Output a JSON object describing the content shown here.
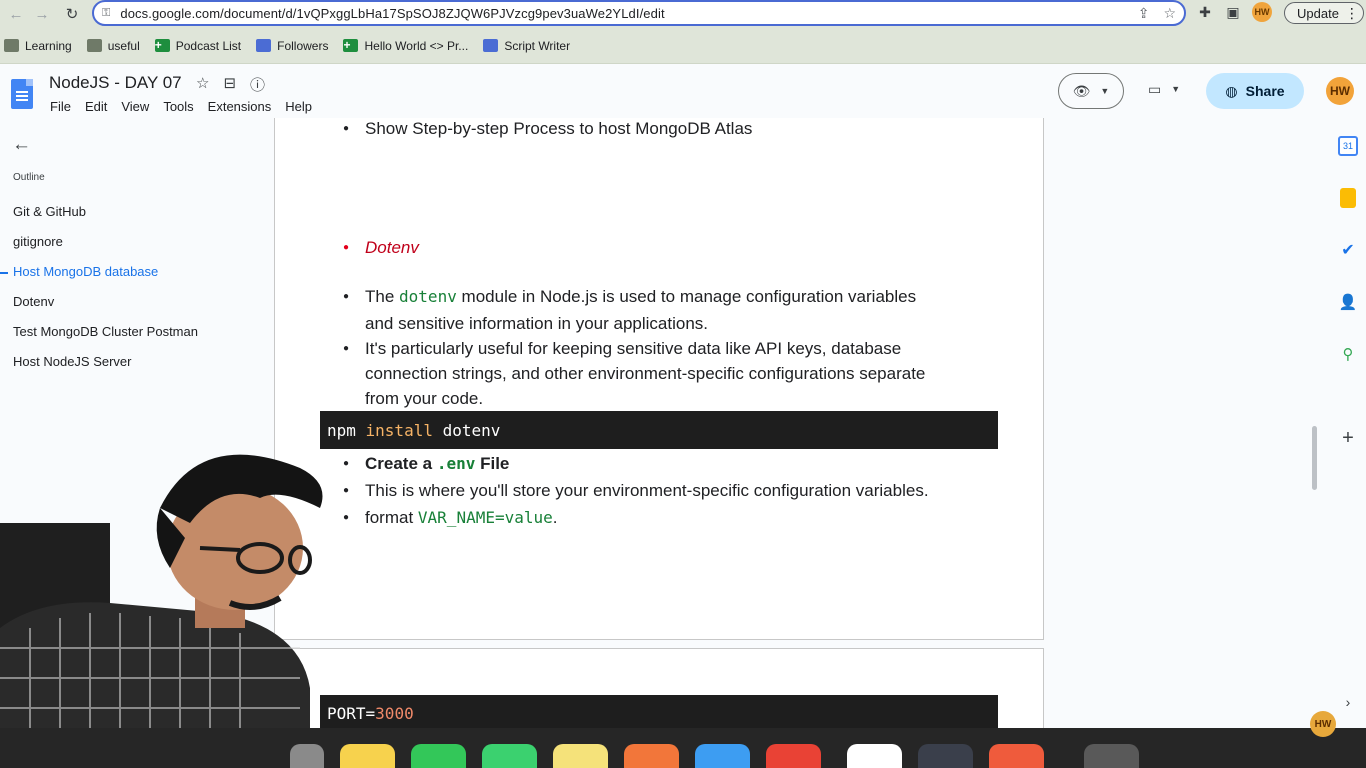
{
  "browser": {
    "url": "docs.google.com/document/d/1vQPxggLbHa17SpSOJ8ZJQW6PJVzcg9pev3uaWe2YLdI/edit",
    "update_label": "Update",
    "profile_initials": "HW",
    "bookmarks": [
      {
        "label": "Learning",
        "icon": "folder-icon"
      },
      {
        "label": "useful",
        "icon": "folder-icon"
      },
      {
        "label": "Podcast List",
        "icon": "sheets-icon"
      },
      {
        "label": "Followers",
        "icon": "docs-icon"
      },
      {
        "label": "Hello World <> Pr...",
        "icon": "sheets-icon"
      },
      {
        "label": "Script Writer",
        "icon": "docs-icon"
      }
    ]
  },
  "docs": {
    "title": "NodeJS - DAY 07",
    "menu": [
      "File",
      "Edit",
      "View",
      "Tools",
      "Extensions",
      "Help"
    ],
    "share_label": "Share",
    "avatar_initials": "HW"
  },
  "outline": {
    "label": "Outline",
    "items": [
      {
        "label": "Git & GitHub",
        "active": false
      },
      {
        "label": "gitignore",
        "active": false
      },
      {
        "label": "Host MongoDB database",
        "active": true
      },
      {
        "label": "Dotenv",
        "active": false
      },
      {
        "label": "Test MongoDB Cluster Postman",
        "active": false
      },
      {
        "label": "Host NodeJS Server",
        "active": false
      }
    ]
  },
  "content": {
    "b1": "Show Step-by-step Process to host MongoDB Atlas",
    "dotenv_heading": "Dotenv",
    "b2_pre": "The ",
    "b2_code": "dotenv",
    "b2_post": " module in Node.js is used to manage configuration variables",
    "b2_cont": "and sensitive information in your applications.",
    "b3_l1": " It's particularly useful for keeping sensitive data like API keys, database",
    "b3_l2": "connection strings, and other environment-specific configurations separate",
    "b3_l3": "from your code.",
    "code1_a": "npm ",
    "code1_kw": "install",
    "code1_b": " dotenv",
    "b4_a": "Create a ",
    "b4_code": ".env",
    "b4_b": " File",
    "b5": "This is where you'll store your environment-specific configuration variables.",
    "b6_a": "format ",
    "b6_code": "VAR_NAME=value",
    "b6_b": ".",
    "code2_a": "PORT=",
    "code2_num": "3000"
  }
}
